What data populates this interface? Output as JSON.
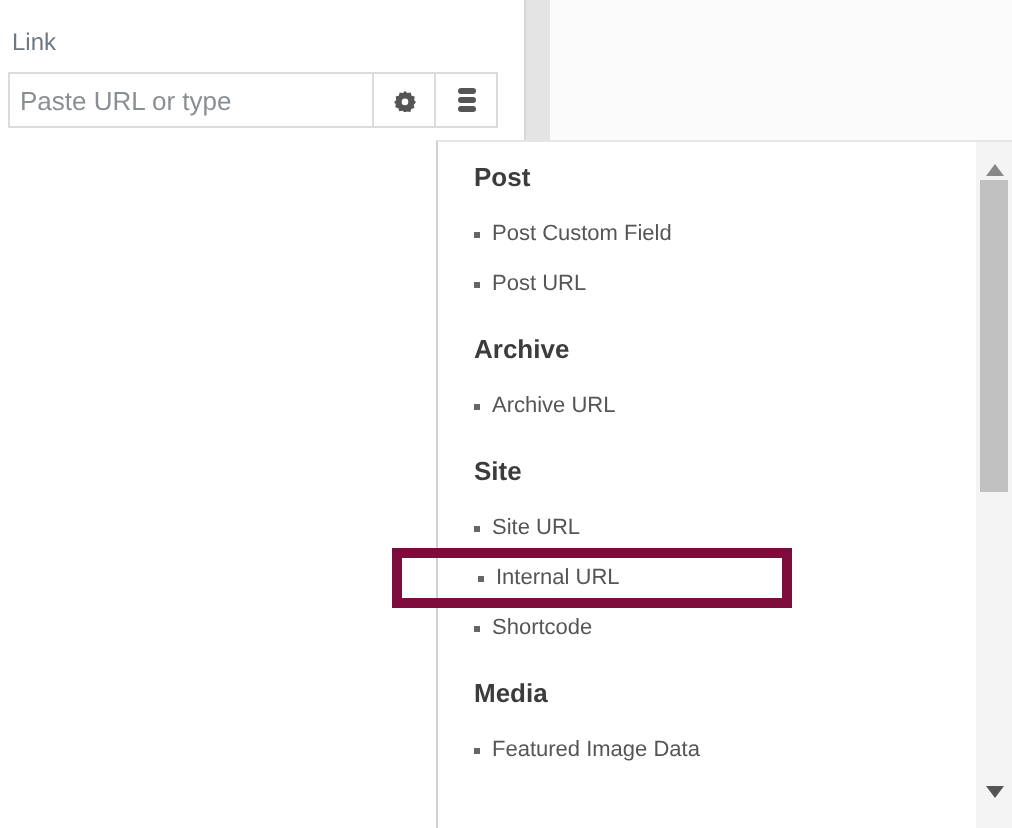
{
  "link_control": {
    "label": "Link",
    "placeholder": "Paste URL or type"
  },
  "dynamic_menu": {
    "groups": [
      {
        "title": "Post",
        "items": [
          {
            "label": "Post Custom Field",
            "highlighted": false
          },
          {
            "label": "Post URL",
            "highlighted": false
          }
        ]
      },
      {
        "title": "Archive",
        "items": [
          {
            "label": "Archive URL",
            "highlighted": false
          }
        ]
      },
      {
        "title": "Site",
        "items": [
          {
            "label": "Site URL",
            "highlighted": false
          },
          {
            "label": "Internal URL",
            "highlighted": true
          },
          {
            "label": "Shortcode",
            "highlighted": false
          }
        ]
      },
      {
        "title": "Media",
        "items": [
          {
            "label": "Featured Image Data",
            "highlighted": false
          }
        ]
      }
    ]
  }
}
